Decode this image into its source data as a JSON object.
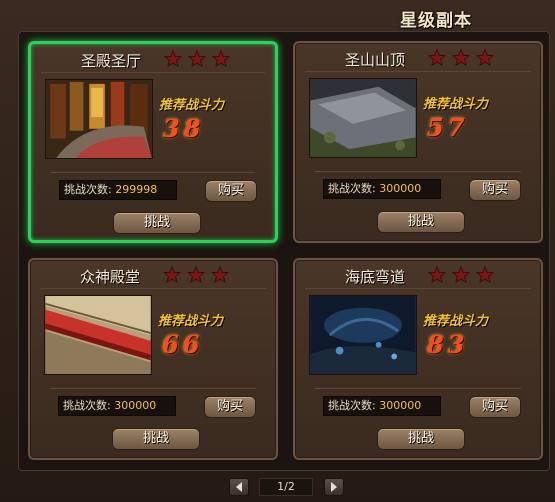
{
  "header": {
    "title": "星级副本"
  },
  "labels": {
    "recommend": "推荐战斗力",
    "challenge_count": "挑战次数:",
    "buy": "购买",
    "challenge": "挑战"
  },
  "cards": [
    {
      "name": "圣殿圣厅",
      "stars": 3,
      "power": "38",
      "count": "299998",
      "selected": true,
      "scene": "temple-hall"
    },
    {
      "name": "圣山山顶",
      "stars": 3,
      "power": "57",
      "count": "300000",
      "selected": false,
      "scene": "mountain-top"
    },
    {
      "name": "众神殿堂",
      "stars": 3,
      "power": "66",
      "count": "300000",
      "selected": false,
      "scene": "gods-palace"
    },
    {
      "name": "海底弯道",
      "stars": 3,
      "power": "83",
      "count": "300000",
      "selected": false,
      "scene": "seabed-curve"
    }
  ],
  "pager": {
    "page": "1/2",
    "prev_icon": "chevron-left-icon",
    "next_icon": "chevron-right-icon"
  },
  "colors": {
    "selected_border": "#2bd15a",
    "power": "#ff4a1c",
    "recommend": "#f2c22f",
    "star": "#8a1a1a"
  }
}
